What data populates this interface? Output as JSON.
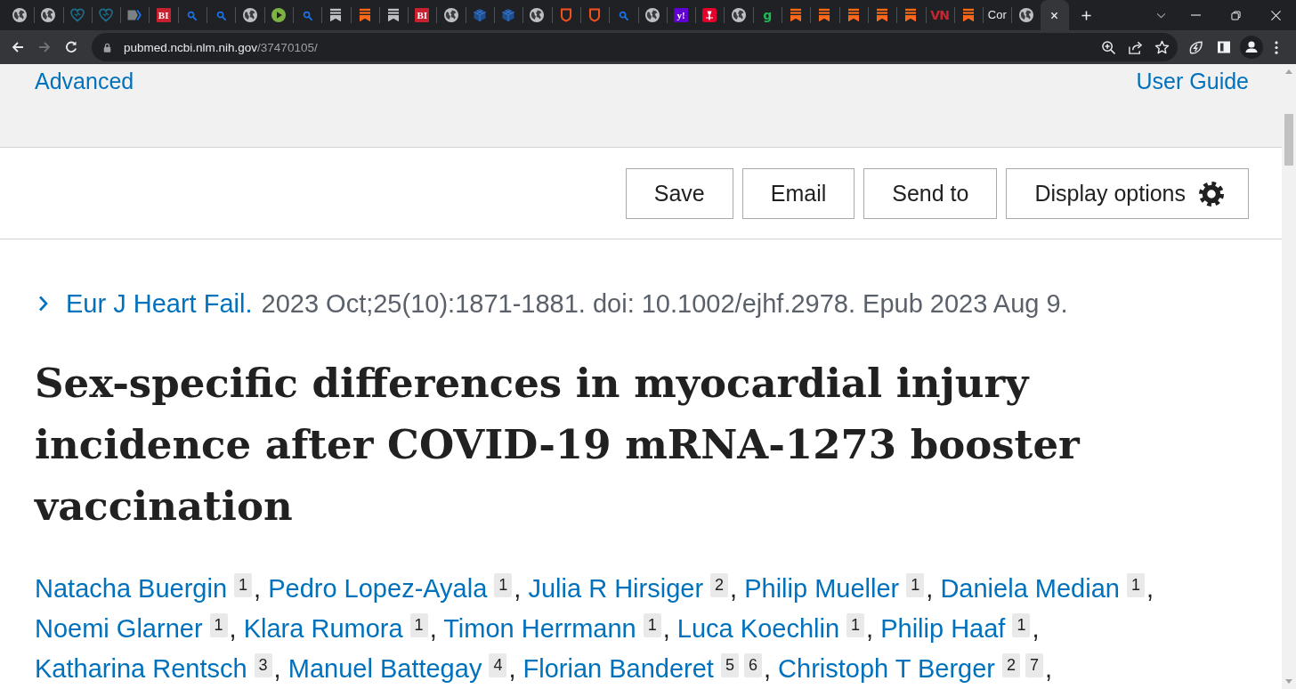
{
  "browser": {
    "tabs": [
      {
        "kind": "globe",
        "selected": false
      },
      {
        "kind": "globe",
        "selected": false
      },
      {
        "kind": "heart",
        "selected": false
      },
      {
        "kind": "heart",
        "selected": false
      },
      {
        "kind": "chevron",
        "selected": false
      },
      {
        "kind": "tile",
        "text": "BI",
        "color": "#c8202f",
        "selected": false
      },
      {
        "kind": "search",
        "selected": false
      },
      {
        "kind": "search",
        "selected": false
      },
      {
        "kind": "globe",
        "selected": false
      },
      {
        "kind": "play",
        "selected": false
      },
      {
        "kind": "search",
        "selected": false
      },
      {
        "kind": "bookmark",
        "color": "#bdc1c6",
        "selected": false
      },
      {
        "kind": "bookmark",
        "color": "#ff6719",
        "selected": false
      },
      {
        "kind": "bookmark",
        "color": "#bdc1c6",
        "selected": false
      },
      {
        "kind": "tile",
        "text": "BI",
        "color": "#c8202f",
        "selected": false
      },
      {
        "kind": "globe",
        "selected": false
      },
      {
        "kind": "cube",
        "selected": false
      },
      {
        "kind": "cube",
        "selected": false
      },
      {
        "kind": "globe",
        "selected": false
      },
      {
        "kind": "shield",
        "selected": false
      },
      {
        "kind": "shield",
        "selected": false
      },
      {
        "kind": "search",
        "selected": false
      },
      {
        "kind": "globe",
        "selected": false
      },
      {
        "kind": "tile",
        "text": "y!",
        "color": "#6001d2",
        "selected": false
      },
      {
        "kind": "torch",
        "selected": false
      },
      {
        "kind": "globe",
        "selected": false
      },
      {
        "kind": "letter",
        "text": "g",
        "color": "#1db954",
        "selected": false
      },
      {
        "kind": "bookmark",
        "color": "#ff6719",
        "selected": false
      },
      {
        "kind": "bookmark",
        "color": "#ff6719",
        "selected": false
      },
      {
        "kind": "bookmark",
        "color": "#ff6719",
        "selected": false
      },
      {
        "kind": "bookmark",
        "color": "#ff6719",
        "selected": false
      },
      {
        "kind": "bookmark",
        "color": "#ff6719",
        "selected": false
      },
      {
        "kind": "letter",
        "text": "VN",
        "color": "#c62832",
        "selected": false
      },
      {
        "kind": "bookmark",
        "color": "#ff6719",
        "selected": false
      },
      {
        "kind": "text",
        "label": "Cor",
        "selected": false
      },
      {
        "kind": "globe",
        "selected": false
      },
      {
        "selected": true
      }
    ],
    "back": {
      "disabled": false
    },
    "forward": {
      "disabled": true
    },
    "address": {
      "host": "pubmed.ncbi.nlm.nih.gov",
      "path": "/37470105/"
    }
  },
  "page": {
    "header_links": [
      "Advanced",
      "User Guide"
    ],
    "actions": [
      "Save",
      "Email",
      "Send to"
    ],
    "display_options": {
      "label": "Display options"
    },
    "citation": {
      "journal": "Eur J Heart Fail.",
      "details": "2023 Oct;25(10):1871-1881. doi: 10.1002/ejhf.2978. Epub 2023 Aug 9."
    },
    "title": "Sex-specific differences in myocardial injury incidence after COVID-19 mRNA-1273 booster vaccination",
    "authors": [
      {
        "name": "Natacha Buergin",
        "affiliations": [
          "1"
        ],
        "separator": ","
      },
      {
        "name": "Pedro Lopez-Ayala",
        "affiliations": [
          "1"
        ],
        "separator": ","
      },
      {
        "name": "Julia R Hirsiger",
        "affiliations": [
          "2"
        ],
        "separator": ","
      },
      {
        "name": "Philip Mueller",
        "affiliations": [
          "1"
        ],
        "separator": ","
      },
      {
        "name": "Daniela Median",
        "affiliations": [
          "1"
        ],
        "separator": ","
      },
      {
        "name": "Noemi Glarner",
        "affiliations": [
          "1"
        ],
        "separator": ","
      },
      {
        "name": "Klara Rumora",
        "affiliations": [
          "1"
        ],
        "separator": ","
      },
      {
        "name": "Timon Herrmann",
        "affiliations": [
          "1"
        ],
        "separator": ","
      },
      {
        "name": "Luca Koechlin",
        "affiliations": [
          "1"
        ],
        "separator": ","
      },
      {
        "name": "Philip Haaf",
        "affiliations": [
          "1"
        ],
        "separator": ","
      },
      {
        "name": "Katharina Rentsch",
        "affiliations": [
          "3"
        ],
        "separator": ","
      },
      {
        "name": "Manuel Battegay",
        "affiliations": [
          "4"
        ],
        "separator": ","
      },
      {
        "name": "Florian Banderet",
        "affiliations": [
          "5",
          "6"
        ],
        "separator": ","
      },
      {
        "name": "Christoph T Berger",
        "affiliations": [
          "2",
          "7"
        ],
        "separator": ","
      }
    ]
  }
}
